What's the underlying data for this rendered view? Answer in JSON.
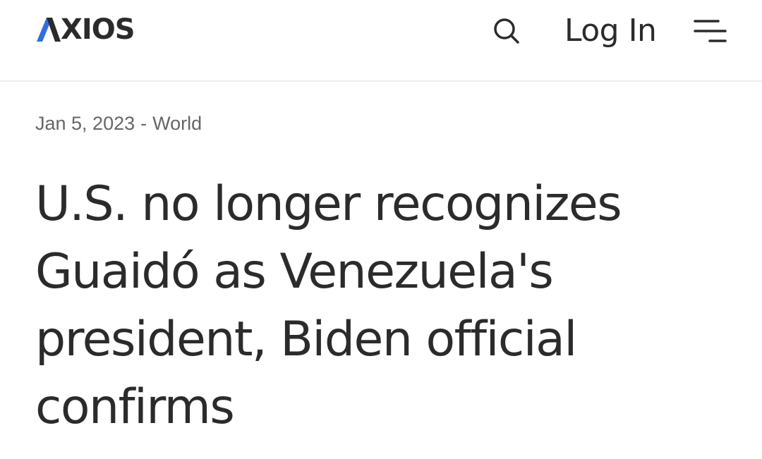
{
  "header": {
    "logo_text": "XIOS",
    "logo_icon": "axios-a-mark",
    "search_icon": "search-icon",
    "login_label": "Log In",
    "menu_icon": "hamburger-menu-icon",
    "brand_colors": {
      "logo_blue": "#2f6fde",
      "text": "#2b2b2b"
    }
  },
  "article": {
    "date": "Jan 5, 2023",
    "separator": "-",
    "section": "World",
    "headline": "U.S. no longer recognizes Guaidó as Venezuela's president, Biden official confirms"
  }
}
